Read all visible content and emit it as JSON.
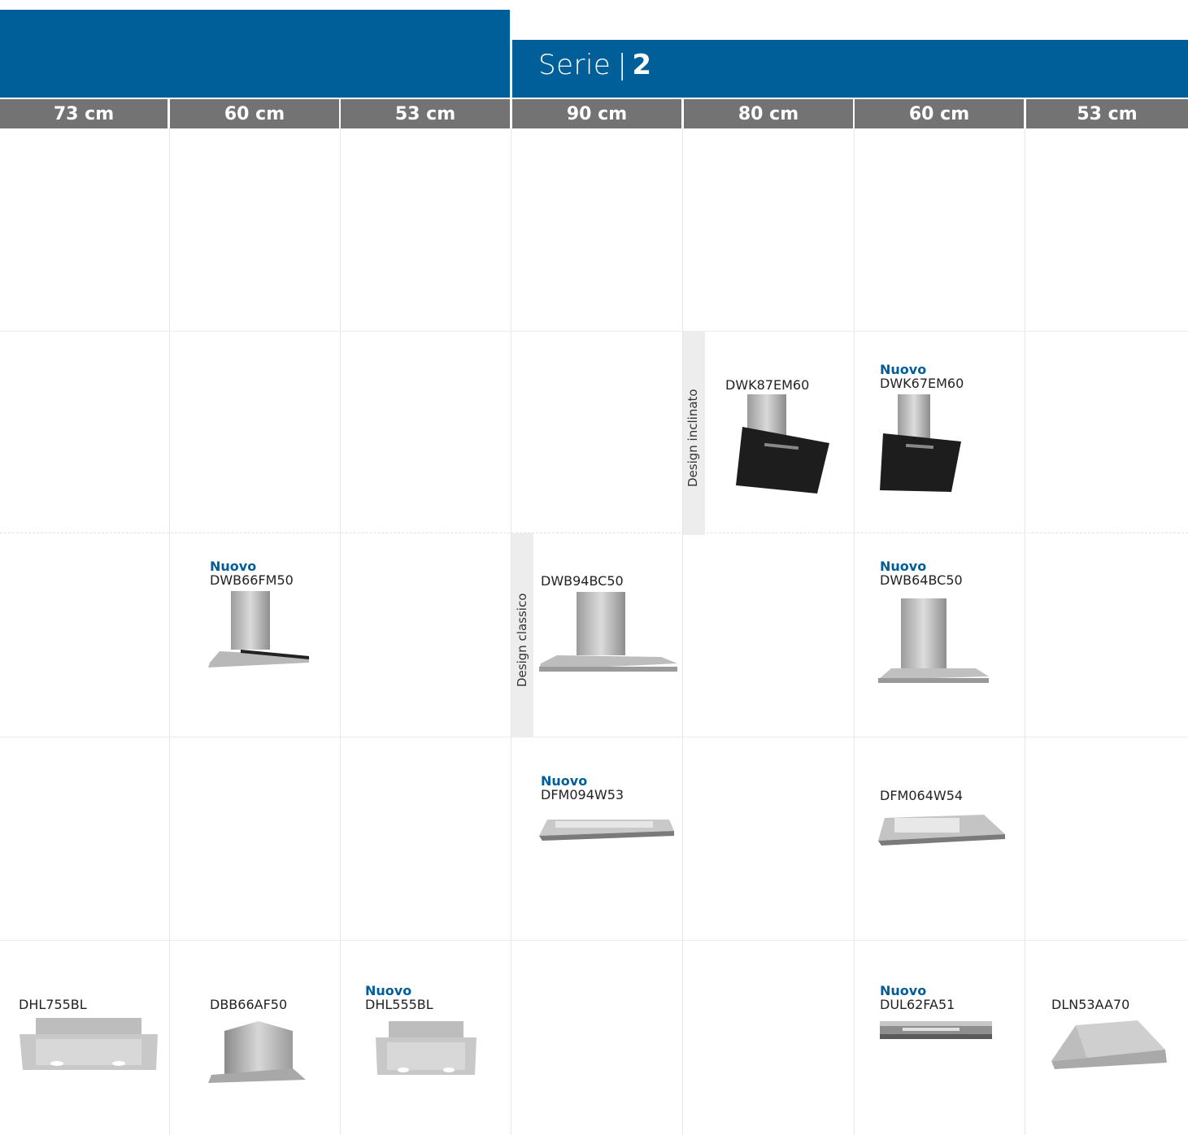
{
  "serie": {
    "label": "Serie",
    "separator": "|",
    "number": "2"
  },
  "colors": {
    "brand": "#005f99",
    "header": "#737373"
  },
  "columns": [
    "73 cm",
    "60 cm",
    "53 cm",
    "90 cm",
    "80 cm",
    "60 cm",
    "53 cm"
  ],
  "design_labels": {
    "inclinato": "Design inclinato",
    "classico": "Design classico"
  },
  "new_label": "Nuovo",
  "products": {
    "dwk87em60": {
      "model": "DWK87EM60"
    },
    "dwk67em60": {
      "model": "DWK67EM60",
      "new": "Nuovo"
    },
    "dwb66fm50": {
      "model": "DWB66FM50",
      "new": "Nuovo"
    },
    "dwb94bc50": {
      "model": "DWB94BC50"
    },
    "dwb64bc50": {
      "model": "DWB64BC50",
      "new": "Nuovo"
    },
    "dfm094w53": {
      "model": "DFM094W53",
      "new": "Nuovo"
    },
    "dfm064w54": {
      "model": "DFM064W54"
    },
    "dhl755bl": {
      "model": "DHL755BL"
    },
    "dbb66af50": {
      "model": "DBB66AF50"
    },
    "dhl555bl": {
      "model": "DHL555BL",
      "new": "Nuovo"
    },
    "dul62fa51": {
      "model": "DUL62FA51",
      "new": "Nuovo"
    },
    "dln53aa70": {
      "model": "DLN53AA70"
    }
  }
}
